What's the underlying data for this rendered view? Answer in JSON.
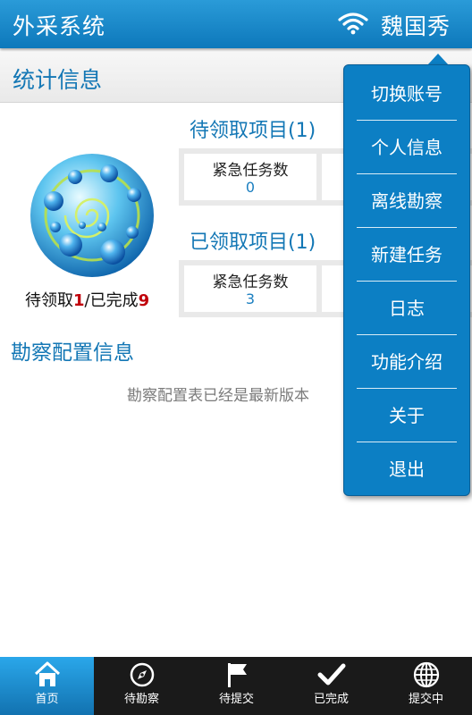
{
  "header": {
    "app_title": "外采系统",
    "user_name": "魏国秀",
    "signal_icon": "wifi-icon"
  },
  "section": {
    "title": "统计信息"
  },
  "summary": {
    "pending_label": "待领取",
    "pending_count": "1",
    "sep": "/",
    "done_label": "已完成",
    "done_count": "9"
  },
  "groups": [
    {
      "title": "待领取项目(1)",
      "cells": [
        {
          "label": "紧急任务数",
          "value": "0"
        }
      ]
    },
    {
      "title": "已领取项目(1)",
      "cells": [
        {
          "label": "紧急任务数",
          "value": "3"
        }
      ]
    }
  ],
  "config": {
    "title": "勘察配置信息",
    "message": "勘察配置表已经是最新版本"
  },
  "menu": {
    "items": [
      "切换账号",
      "个人信息",
      "离线勘察",
      "新建任务",
      "日志",
      "功能介绍",
      "关于",
      "退出"
    ]
  },
  "tabs": [
    {
      "label": "首页",
      "icon": "home-icon",
      "active": true
    },
    {
      "label": "待勘察",
      "icon": "compass-icon"
    },
    {
      "label": "待提交",
      "icon": "flag-icon"
    },
    {
      "label": "已完成",
      "icon": "check-icon"
    },
    {
      "label": "提交中",
      "icon": "globe-icon"
    }
  ],
  "colors": {
    "accent": "#1377b5",
    "menu_bg": "#0c7fc4",
    "highlight_number": "#c0000a",
    "tab_active": "#2aa7ea"
  }
}
